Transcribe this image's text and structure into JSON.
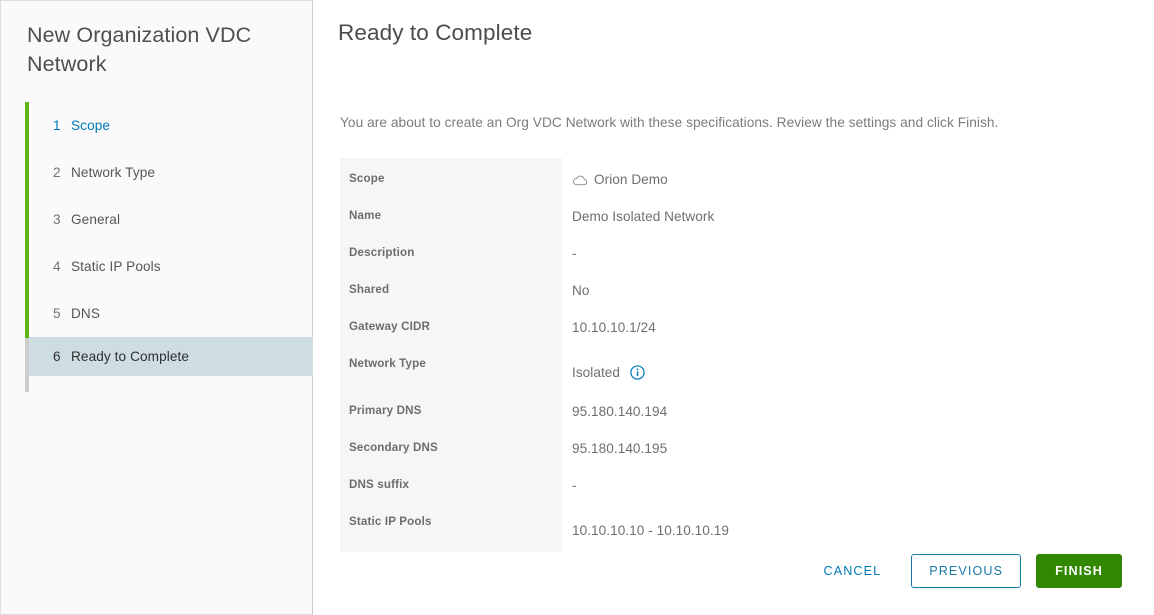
{
  "sidebar": {
    "title": "New Organization VDC Network",
    "steps": [
      {
        "num": "1",
        "label": "Scope",
        "state": "link"
      },
      {
        "num": "2",
        "label": "Network Type",
        "state": "done"
      },
      {
        "num": "3",
        "label": "General",
        "state": "done"
      },
      {
        "num": "4",
        "label": "Static IP Pools",
        "state": "done"
      },
      {
        "num": "5",
        "label": "DNS",
        "state": "done"
      },
      {
        "num": "6",
        "label": "Ready to Complete",
        "state": "current"
      }
    ]
  },
  "main": {
    "page_title": "Ready to Complete",
    "intro": "You are about to create an Org VDC Network with these specifications. Review the settings and click Finish.",
    "summary_rows": [
      {
        "label": "Scope",
        "value": "Orion Demo",
        "icon": "cloud-icon"
      },
      {
        "label": "Name",
        "value": "Demo Isolated Network",
        "icon": ""
      },
      {
        "label": "Description",
        "value": "-",
        "icon": ""
      },
      {
        "label": "Shared",
        "value": "No",
        "icon": ""
      },
      {
        "label": "Gateway CIDR",
        "value": "10.10.10.1/24",
        "icon": ""
      },
      {
        "label": "Network Type",
        "value": "Isolated",
        "icon": "info-icon"
      },
      {
        "label": "Primary DNS",
        "value": "95.180.140.194",
        "icon": ""
      },
      {
        "label": "Secondary DNS",
        "value": "95.180.140.195",
        "icon": ""
      },
      {
        "label": "DNS suffix",
        "value": "-",
        "icon": ""
      },
      {
        "label": "Static IP Pools",
        "value": "10.10.10.10 - 10.10.10.19",
        "icon": ""
      }
    ]
  },
  "footer": {
    "cancel_label": "CANCEL",
    "previous_label": "PREVIOUS",
    "finish_label": "FINISH"
  },
  "colors": {
    "progress_done": "#60b515",
    "progress_rest": "#cccccc",
    "current_step_bg": "#cdddE3",
    "link_blue": "#0079b8",
    "outline_blue": "#1a7ba8",
    "finish_green": "#318700",
    "label_column_bg": "#f6f6f6",
    "sidebar_bg": "#fafafa"
  }
}
